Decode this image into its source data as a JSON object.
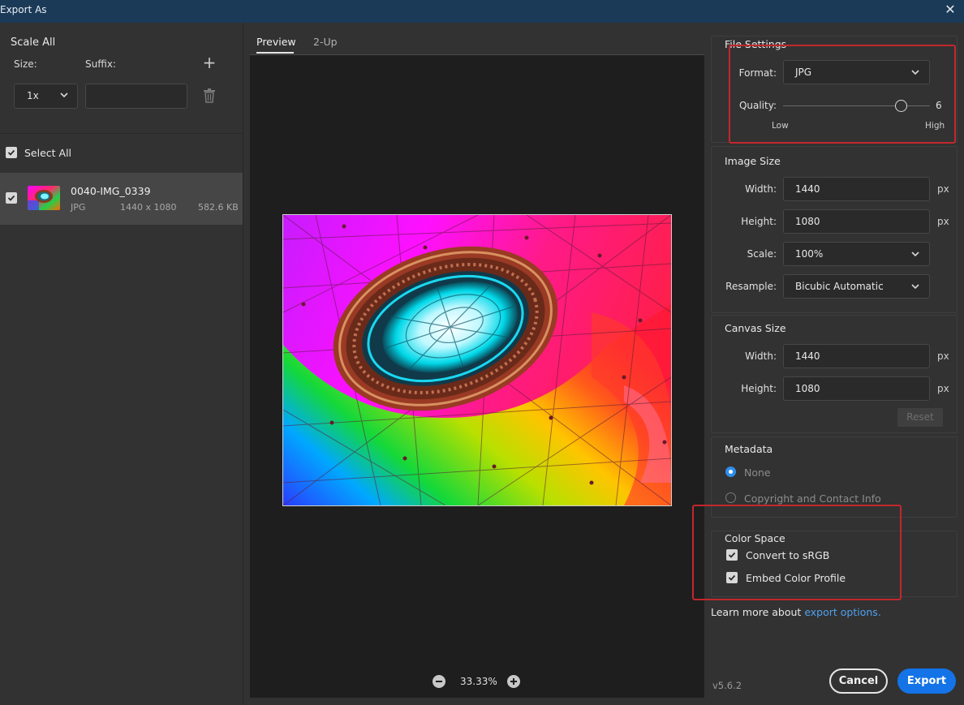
{
  "window": {
    "title": "Export As",
    "close_icon": "close-icon"
  },
  "left": {
    "scale_all_title": "Scale All",
    "size_label": "Size:",
    "suffix_label": "Suffix:",
    "size_value": "1x",
    "suffix_value": "",
    "select_all_label": "Select All",
    "select_all_checked": true,
    "files": [
      {
        "name": "0040-IMG_0339",
        "format": "JPG",
        "dimensions": "1440 x 1080",
        "size": "582.6 KB",
        "checked": true
      }
    ]
  },
  "preview": {
    "tabs": [
      {
        "label": "Preview",
        "active": true
      },
      {
        "label": "2-Up",
        "active": false
      }
    ],
    "zoom": "33.33%"
  },
  "file_settings": {
    "title": "File Settings",
    "format_label": "Format:",
    "format_value": "JPG",
    "quality_label": "Quality:",
    "quality_value": "6",
    "quality_level": 0.83,
    "low_label": "Low",
    "high_label": "High"
  },
  "image_size": {
    "title": "Image Size",
    "width_label": "Width:",
    "width_value": "1440",
    "height_label": "Height:",
    "height_value": "1080",
    "scale_label": "Scale:",
    "scale_value": "100%",
    "resample_label": "Resample:",
    "resample_value": "Bicubic Automatic",
    "unit": "px"
  },
  "canvas_size": {
    "title": "Canvas Size",
    "width_label": "Width:",
    "width_value": "1440",
    "height_label": "Height:",
    "height_value": "1080",
    "unit": "px",
    "reset_label": "Reset"
  },
  "metadata": {
    "title": "Metadata",
    "options": [
      {
        "label": "None",
        "selected": true
      },
      {
        "label": "Copyright and Contact Info",
        "selected": false
      }
    ]
  },
  "color_space": {
    "title": "Color Space",
    "convert_label": "Convert to sRGB",
    "embed_label": "Embed Color Profile"
  },
  "footer": {
    "learn_prefix": "Learn more about ",
    "learn_link": "export options.",
    "version": "v5.6.2",
    "cancel_label": "Cancel",
    "export_label": "Export"
  },
  "colors": {
    "accent": "#1473e6",
    "highlight": "#c2272d",
    "titlebar": "#1b3a58",
    "link": "#4ea1f0"
  }
}
